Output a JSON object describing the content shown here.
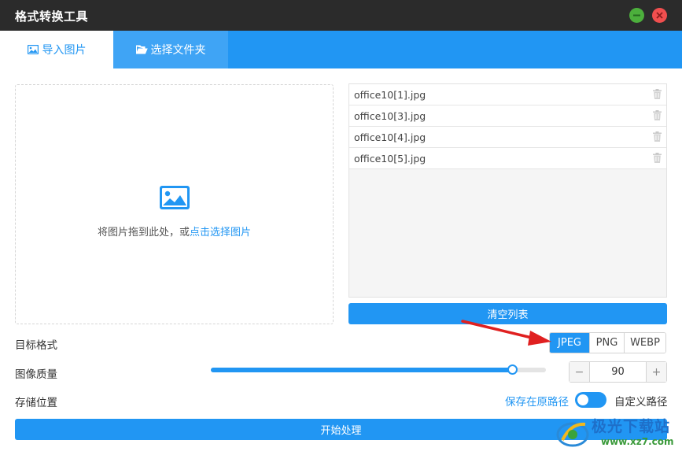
{
  "app": {
    "title": "格式转换工具"
  },
  "colors": {
    "accent": "#2196f3",
    "titlebar": "#2b2b2b",
    "minimize": "#4caf3c",
    "close": "#f04f4f",
    "arrow": "#e02020"
  },
  "tabs": [
    {
      "label": "导入图片",
      "icon": "image-icon",
      "active": true
    },
    {
      "label": "选择文件夹",
      "icon": "folder-open-icon",
      "active": false
    }
  ],
  "dropzone": {
    "icon": "image-icon",
    "text_prefix": "将图片拖到此处，或",
    "link_text": "点击选择图片"
  },
  "file_list": {
    "items": [
      {
        "name": "office10[1].jpg",
        "icon": "trash-icon"
      },
      {
        "name": "office10[3].jpg",
        "icon": "trash-icon"
      },
      {
        "name": "office10[4].jpg",
        "icon": "trash-icon"
      },
      {
        "name": "office10[5].jpg",
        "icon": "trash-icon"
      }
    ],
    "clear_label": "清空列表"
  },
  "format": {
    "label": "目标格式",
    "options": [
      "JPEG",
      "PNG",
      "WEBP"
    ],
    "selected": "JPEG"
  },
  "quality": {
    "label": "图像质量",
    "value": "90",
    "value_fraction": 0.9,
    "minus": "−",
    "plus": "+"
  },
  "storage": {
    "label": "存储位置",
    "original_path": "保存在原路径",
    "custom_path": "自定义路径",
    "toggle_on": true
  },
  "start_label": "开始处理",
  "watermark": {
    "text": "极光下载站",
    "url": "www.xz7.com"
  }
}
